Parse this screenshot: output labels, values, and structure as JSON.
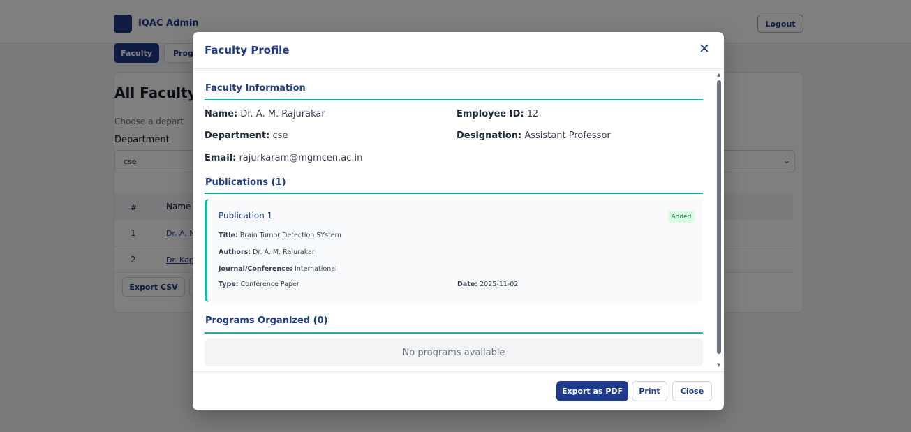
{
  "app": {
    "brand": "IQAC Admin",
    "logout": "Logout",
    "tabs": [
      {
        "label": "Faculty"
      },
      {
        "label": "Progr"
      }
    ]
  },
  "page": {
    "title": "All Faculty",
    "subtitle": "Choose a depart",
    "department_label": "Department",
    "department_value": "cse",
    "table": {
      "headers": [
        "#",
        "Name"
      ],
      "rows": [
        {
          "num": "1",
          "name": "Dr. A. M"
        },
        {
          "num": "2",
          "name": "Dr. Kap"
        }
      ]
    },
    "export_csv": "Export CSV"
  },
  "modal": {
    "title": "Faculty Profile",
    "close_icon": "close-icon",
    "info_section": "Faculty Information",
    "fields": {
      "name_label": "Name:",
      "name_value": "Dr. A. M. Rajurakar",
      "emp_label": "Employee ID:",
      "emp_value": "12",
      "dept_label": "Department:",
      "dept_value": "cse",
      "desig_label": "Designation:",
      "desig_value": "Assistant Professor",
      "email_label": "Email:",
      "email_value": "rajurkaram@mgmcen.ac.in"
    },
    "publications_section": "Publications (1)",
    "publication": {
      "heading": "Publication 1",
      "badge": "Added",
      "title_label": "Title:",
      "title_value": "Brain Tumor Detection SYstem",
      "authors_label": "Authors:",
      "authors_value": "Dr. A. M. Rajurakar",
      "journal_label": "Journal/Conference:",
      "journal_value": "International",
      "type_label": "Type:",
      "type_value": "Conference Paper",
      "date_label": "Date:",
      "date_value": "2025-11-02"
    },
    "programs_section": "Programs Organized (0)",
    "programs_empty": "No programs available",
    "footer": {
      "export_pdf": "Export as PDF",
      "print": "Print",
      "close": "Close"
    }
  },
  "colors": {
    "primary": "#1e3a8a",
    "accent": "#14b8a6",
    "badge_bg": "#dcfce7",
    "badge_text": "#15803d"
  }
}
